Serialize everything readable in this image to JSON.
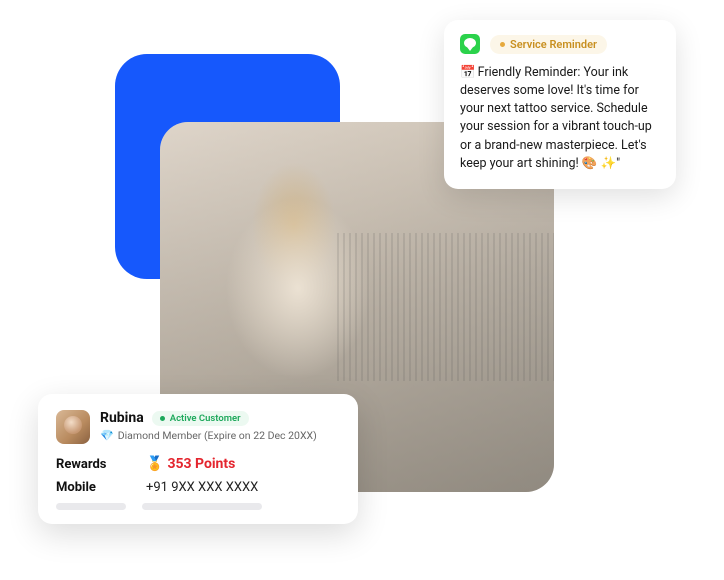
{
  "reminder": {
    "badge_label": "Service Reminder",
    "message": "Friendly Reminder: Your ink deserves some love! It's time for your next tattoo service. Schedule your session for a vibrant touch-up or a brand-new masterpiece. Let's keep your art shining! 🎨 ✨\""
  },
  "customer": {
    "name": "Rubina",
    "status_label": "Active Customer",
    "membership_text": "Diamond Member (Expire on 22 Dec 20XX)",
    "rewards_label": "Rewards",
    "points_text": "353 Points",
    "mobile_label": "Mobile",
    "mobile_value": "+91 9XX XXX XXXX"
  }
}
